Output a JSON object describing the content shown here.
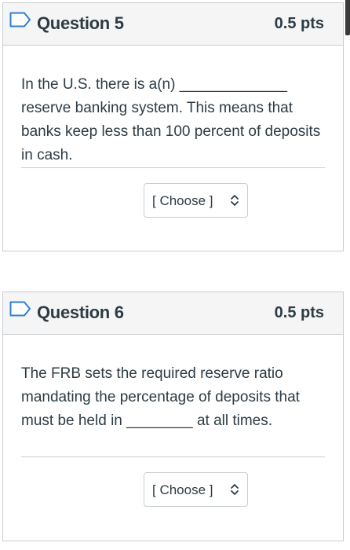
{
  "questions": [
    {
      "title": "Question 5",
      "points": "0.5 pts",
      "text": "In the U.S. there is a(n) _____________ reserve banking system. This means that banks keep less than 100 percent of deposits in cash.",
      "select": {
        "selected": "[ Choose ]"
      }
    },
    {
      "title": "Question 6",
      "points": "0.5 pts",
      "text": "The FRB sets the required reserve ratio mandating the percentage of deposits that must be held in ________ at all times.",
      "select": {
        "selected": "[ Choose ]"
      }
    }
  ],
  "colors": {
    "text": "#2d3b45",
    "header_bg": "#f5f5f5",
    "border": "#c7cdd1",
    "flag": "#2d7fd3"
  },
  "icons": {
    "flag": "bookmark-flag-icon",
    "select_chevron": "up-down-chevron-icon"
  }
}
